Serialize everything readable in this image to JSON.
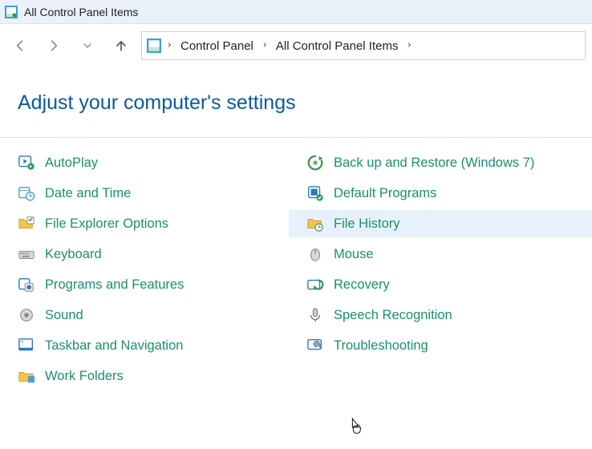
{
  "titlebar": {
    "title": "All Control Panel Items"
  },
  "breadcrumbs": {
    "root": "Control Panel",
    "current": "All Control Panel Items"
  },
  "heading": "Adjust your computer's settings",
  "items_left": [
    {
      "id": "autoplay",
      "label": "AutoPlay"
    },
    {
      "id": "date-and-time",
      "label": "Date and Time"
    },
    {
      "id": "file-explorer-options",
      "label": "File Explorer Options"
    },
    {
      "id": "keyboard",
      "label": "Keyboard"
    },
    {
      "id": "programs-and-features",
      "label": "Programs and Features"
    },
    {
      "id": "sound",
      "label": "Sound"
    },
    {
      "id": "taskbar-and-navigation",
      "label": "Taskbar and Navigation"
    },
    {
      "id": "work-folders",
      "label": "Work Folders"
    }
  ],
  "items_right": [
    {
      "id": "backup-and-restore",
      "label": "Back up and Restore (Windows 7)"
    },
    {
      "id": "default-programs",
      "label": "Default Programs"
    },
    {
      "id": "file-history",
      "label": "File History",
      "hovered": true
    },
    {
      "id": "mouse",
      "label": "Mouse"
    },
    {
      "id": "recovery",
      "label": "Recovery"
    },
    {
      "id": "speech-recognition",
      "label": "Speech Recognition"
    },
    {
      "id": "troubleshooting",
      "label": "Troubleshooting"
    }
  ],
  "colors": {
    "link": "#1a8f70",
    "heading": "#0a5aa0",
    "hover_bg": "#e7f1fb"
  }
}
